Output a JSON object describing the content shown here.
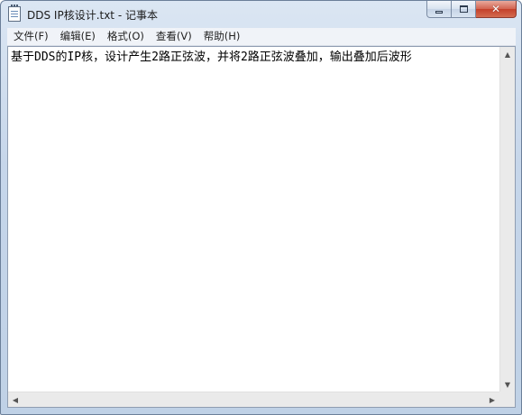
{
  "window": {
    "title": "DDS IP核设计.txt - 记事本"
  },
  "caption": {
    "minimize_icon": "minimize-icon",
    "maximize_icon": "maximize-icon",
    "close_glyph": "✕"
  },
  "menu": {
    "items": [
      {
        "label": "文件(F)"
      },
      {
        "label": "编辑(E)"
      },
      {
        "label": "格式(O)"
      },
      {
        "label": "查看(V)"
      },
      {
        "label": "帮助(H)"
      }
    ]
  },
  "editor": {
    "content": "基于DDS的IP核，设计产生2路正弦波，并将2路正弦波叠加，输出叠加后波形"
  },
  "scrollbars": {
    "up_arrow": "▲",
    "down_arrow": "▼",
    "left_arrow": "◀",
    "right_arrow": "▶"
  },
  "colors": {
    "frame": "#c6d6ea",
    "close_button": "#c3402b",
    "menubar": "#f0f3f8"
  }
}
